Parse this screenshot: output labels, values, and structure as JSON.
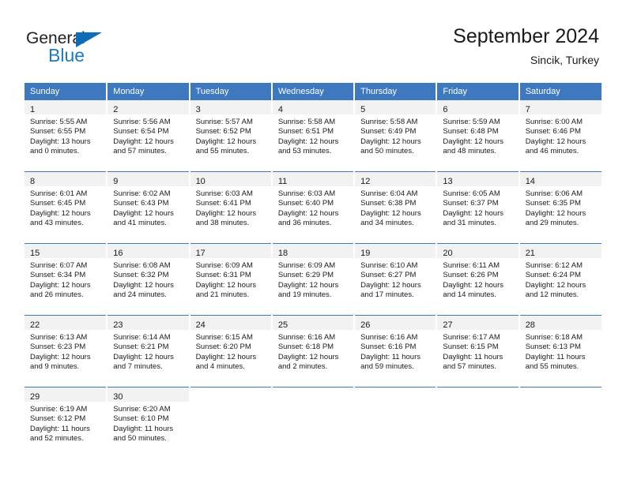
{
  "brand": {
    "name_top": "General",
    "name_bottom": "Blue",
    "triangle_color": "#0f6cb6",
    "blue_color": "#1a7ac4"
  },
  "header": {
    "title": "September 2024",
    "subtitle": "Sincik, Turkey"
  },
  "theme": {
    "header_blue": "#3e79c0",
    "datenum_band": "#f2f2f2",
    "text": "#1a1a1a"
  },
  "calendar": {
    "weekday_headers": [
      "Sunday",
      "Monday",
      "Tuesday",
      "Wednesday",
      "Thursday",
      "Friday",
      "Saturday"
    ],
    "labels": {
      "sunrise": "Sunrise:",
      "sunset": "Sunset:",
      "daylight": "Daylight:"
    },
    "weeks": [
      [
        {
          "day": "1",
          "sunrise": "Sunrise: 5:55 AM",
          "sunset": "Sunset: 6:55 PM",
          "daylight_line1": "Daylight: 13 hours",
          "daylight_line2": "and 0 minutes."
        },
        {
          "day": "2",
          "sunrise": "Sunrise: 5:56 AM",
          "sunset": "Sunset: 6:54 PM",
          "daylight_line1": "Daylight: 12 hours",
          "daylight_line2": "and 57 minutes."
        },
        {
          "day": "3",
          "sunrise": "Sunrise: 5:57 AM",
          "sunset": "Sunset: 6:52 PM",
          "daylight_line1": "Daylight: 12 hours",
          "daylight_line2": "and 55 minutes."
        },
        {
          "day": "4",
          "sunrise": "Sunrise: 5:58 AM",
          "sunset": "Sunset: 6:51 PM",
          "daylight_line1": "Daylight: 12 hours",
          "daylight_line2": "and 53 minutes."
        },
        {
          "day": "5",
          "sunrise": "Sunrise: 5:58 AM",
          "sunset": "Sunset: 6:49 PM",
          "daylight_line1": "Daylight: 12 hours",
          "daylight_line2": "and 50 minutes."
        },
        {
          "day": "6",
          "sunrise": "Sunrise: 5:59 AM",
          "sunset": "Sunset: 6:48 PM",
          "daylight_line1": "Daylight: 12 hours",
          "daylight_line2": "and 48 minutes."
        },
        {
          "day": "7",
          "sunrise": "Sunrise: 6:00 AM",
          "sunset": "Sunset: 6:46 PM",
          "daylight_line1": "Daylight: 12 hours",
          "daylight_line2": "and 46 minutes."
        }
      ],
      [
        {
          "day": "8",
          "sunrise": "Sunrise: 6:01 AM",
          "sunset": "Sunset: 6:45 PM",
          "daylight_line1": "Daylight: 12 hours",
          "daylight_line2": "and 43 minutes."
        },
        {
          "day": "9",
          "sunrise": "Sunrise: 6:02 AM",
          "sunset": "Sunset: 6:43 PM",
          "daylight_line1": "Daylight: 12 hours",
          "daylight_line2": "and 41 minutes."
        },
        {
          "day": "10",
          "sunrise": "Sunrise: 6:03 AM",
          "sunset": "Sunset: 6:41 PM",
          "daylight_line1": "Daylight: 12 hours",
          "daylight_line2": "and 38 minutes."
        },
        {
          "day": "11",
          "sunrise": "Sunrise: 6:03 AM",
          "sunset": "Sunset: 6:40 PM",
          "daylight_line1": "Daylight: 12 hours",
          "daylight_line2": "and 36 minutes."
        },
        {
          "day": "12",
          "sunrise": "Sunrise: 6:04 AM",
          "sunset": "Sunset: 6:38 PM",
          "daylight_line1": "Daylight: 12 hours",
          "daylight_line2": "and 34 minutes."
        },
        {
          "day": "13",
          "sunrise": "Sunrise: 6:05 AM",
          "sunset": "Sunset: 6:37 PM",
          "daylight_line1": "Daylight: 12 hours",
          "daylight_line2": "and 31 minutes."
        },
        {
          "day": "14",
          "sunrise": "Sunrise: 6:06 AM",
          "sunset": "Sunset: 6:35 PM",
          "daylight_line1": "Daylight: 12 hours",
          "daylight_line2": "and 29 minutes."
        }
      ],
      [
        {
          "day": "15",
          "sunrise": "Sunrise: 6:07 AM",
          "sunset": "Sunset: 6:34 PM",
          "daylight_line1": "Daylight: 12 hours",
          "daylight_line2": "and 26 minutes."
        },
        {
          "day": "16",
          "sunrise": "Sunrise: 6:08 AM",
          "sunset": "Sunset: 6:32 PM",
          "daylight_line1": "Daylight: 12 hours",
          "daylight_line2": "and 24 minutes."
        },
        {
          "day": "17",
          "sunrise": "Sunrise: 6:09 AM",
          "sunset": "Sunset: 6:31 PM",
          "daylight_line1": "Daylight: 12 hours",
          "daylight_line2": "and 21 minutes."
        },
        {
          "day": "18",
          "sunrise": "Sunrise: 6:09 AM",
          "sunset": "Sunset: 6:29 PM",
          "daylight_line1": "Daylight: 12 hours",
          "daylight_line2": "and 19 minutes."
        },
        {
          "day": "19",
          "sunrise": "Sunrise: 6:10 AM",
          "sunset": "Sunset: 6:27 PM",
          "daylight_line1": "Daylight: 12 hours",
          "daylight_line2": "and 17 minutes."
        },
        {
          "day": "20",
          "sunrise": "Sunrise: 6:11 AM",
          "sunset": "Sunset: 6:26 PM",
          "daylight_line1": "Daylight: 12 hours",
          "daylight_line2": "and 14 minutes."
        },
        {
          "day": "21",
          "sunrise": "Sunrise: 6:12 AM",
          "sunset": "Sunset: 6:24 PM",
          "daylight_line1": "Daylight: 12 hours",
          "daylight_line2": "and 12 minutes."
        }
      ],
      [
        {
          "day": "22",
          "sunrise": "Sunrise: 6:13 AM",
          "sunset": "Sunset: 6:23 PM",
          "daylight_line1": "Daylight: 12 hours",
          "daylight_line2": "and 9 minutes."
        },
        {
          "day": "23",
          "sunrise": "Sunrise: 6:14 AM",
          "sunset": "Sunset: 6:21 PM",
          "daylight_line1": "Daylight: 12 hours",
          "daylight_line2": "and 7 minutes."
        },
        {
          "day": "24",
          "sunrise": "Sunrise: 6:15 AM",
          "sunset": "Sunset: 6:20 PM",
          "daylight_line1": "Daylight: 12 hours",
          "daylight_line2": "and 4 minutes."
        },
        {
          "day": "25",
          "sunrise": "Sunrise: 6:16 AM",
          "sunset": "Sunset: 6:18 PM",
          "daylight_line1": "Daylight: 12 hours",
          "daylight_line2": "and 2 minutes."
        },
        {
          "day": "26",
          "sunrise": "Sunrise: 6:16 AM",
          "sunset": "Sunset: 6:16 PM",
          "daylight_line1": "Daylight: 11 hours",
          "daylight_line2": "and 59 minutes."
        },
        {
          "day": "27",
          "sunrise": "Sunrise: 6:17 AM",
          "sunset": "Sunset: 6:15 PM",
          "daylight_line1": "Daylight: 11 hours",
          "daylight_line2": "and 57 minutes."
        },
        {
          "day": "28",
          "sunrise": "Sunrise: 6:18 AM",
          "sunset": "Sunset: 6:13 PM",
          "daylight_line1": "Daylight: 11 hours",
          "daylight_line2": "and 55 minutes."
        }
      ],
      [
        {
          "day": "29",
          "sunrise": "Sunrise: 6:19 AM",
          "sunset": "Sunset: 6:12 PM",
          "daylight_line1": "Daylight: 11 hours",
          "daylight_line2": "and 52 minutes."
        },
        {
          "day": "30",
          "sunrise": "Sunrise: 6:20 AM",
          "sunset": "Sunset: 6:10 PM",
          "daylight_line1": "Daylight: 11 hours",
          "daylight_line2": "and 50 minutes."
        },
        {
          "day": "",
          "sunrise": "",
          "sunset": "",
          "daylight_line1": "",
          "daylight_line2": ""
        },
        {
          "day": "",
          "sunrise": "",
          "sunset": "",
          "daylight_line1": "",
          "daylight_line2": ""
        },
        {
          "day": "",
          "sunrise": "",
          "sunset": "",
          "daylight_line1": "",
          "daylight_line2": ""
        },
        {
          "day": "",
          "sunrise": "",
          "sunset": "",
          "daylight_line1": "",
          "daylight_line2": ""
        },
        {
          "day": "",
          "sunrise": "",
          "sunset": "",
          "daylight_line1": "",
          "daylight_line2": ""
        }
      ]
    ]
  }
}
